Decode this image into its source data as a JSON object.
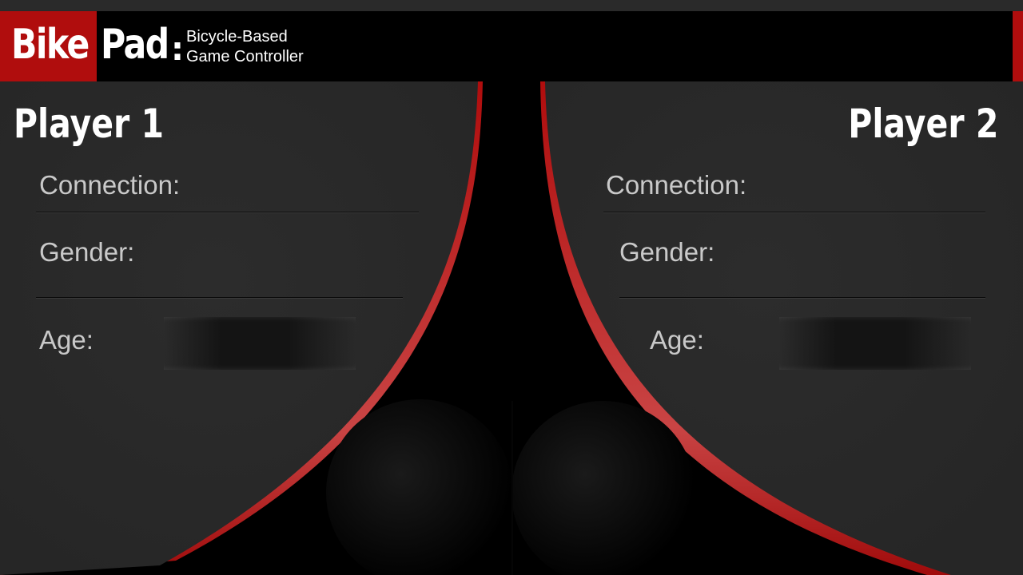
{
  "header": {
    "logo_bike": "Bike",
    "logo_pad": "Pad",
    "logo_colon": ":",
    "subtitle_line1": "Bicycle-Based",
    "subtitle_line2": "Game Controller"
  },
  "player1": {
    "title": "Player 1",
    "connection_label": "Connection:",
    "gender_label": "Gender:",
    "age_label": "Age:"
  },
  "player2": {
    "title": "Player 2",
    "connection_label": "Connection:",
    "gender_label": "Gender:",
    "age_label": "Age:"
  },
  "colors": {
    "brand_red": "#b00d0d",
    "panel_gray": "#2a2a2a",
    "background": "#000000"
  }
}
